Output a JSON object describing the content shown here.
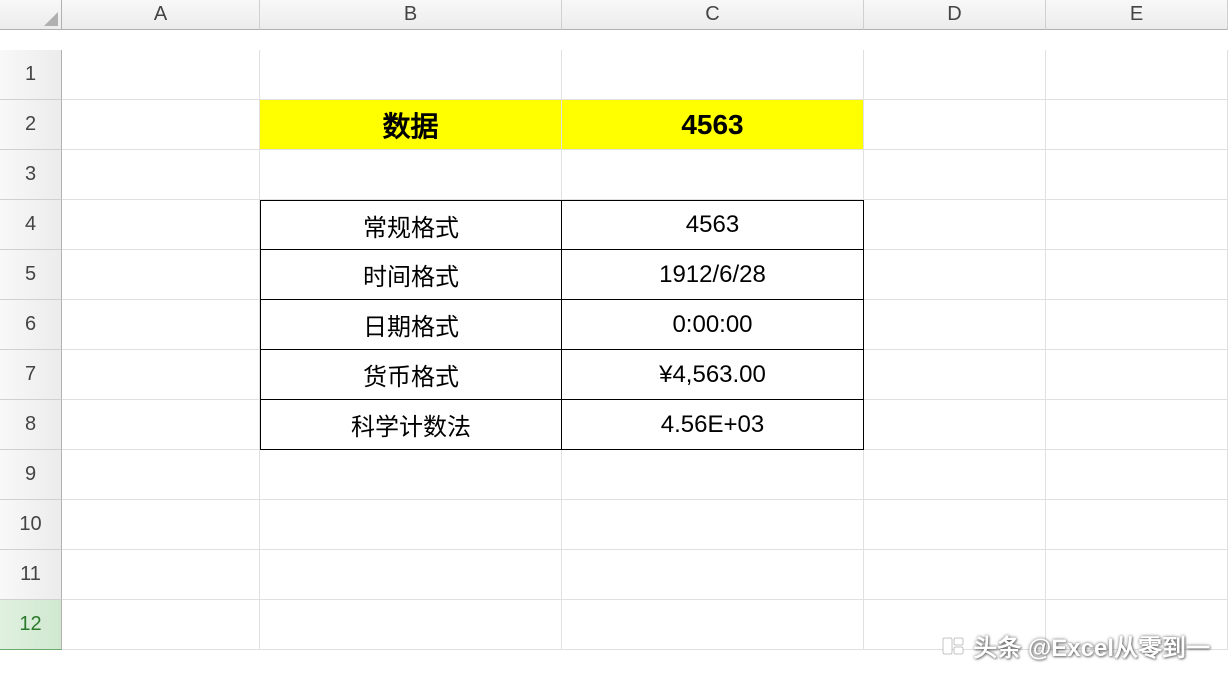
{
  "columns": [
    "A",
    "B",
    "C",
    "D",
    "E"
  ],
  "rows": [
    "1",
    "2",
    "3",
    "4",
    "5",
    "6",
    "7",
    "8",
    "9",
    "10",
    "11",
    "12"
  ],
  "header": {
    "label": "数据",
    "value": "4563"
  },
  "formats": [
    {
      "label": "常规格式",
      "value": "4563"
    },
    {
      "label": "时间格式",
      "value": "1912/6/28"
    },
    {
      "label": "日期格式",
      "value": "0:00:00"
    },
    {
      "label": "货币格式",
      "value": "¥4,563.00"
    },
    {
      "label": "科学计数法",
      "value": "4.56E+03"
    }
  ],
  "watermark": "头条 @Excel从零到一"
}
